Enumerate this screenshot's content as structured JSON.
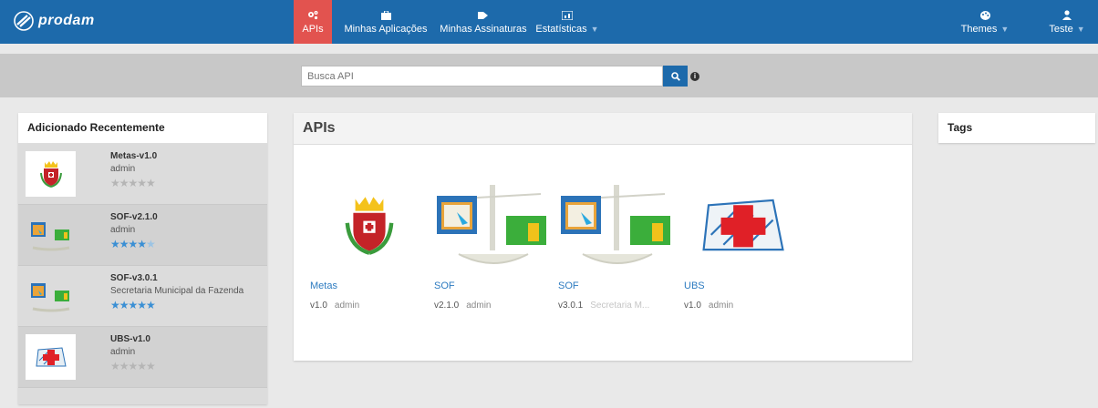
{
  "brand": {
    "name": "prodam"
  },
  "nav": {
    "items": [
      {
        "label": "APIs",
        "icon": "gears-icon",
        "active": true
      },
      {
        "label": "Minhas Aplicações",
        "icon": "briefcase-icon"
      },
      {
        "label": "Minhas Assinaturas",
        "icon": "tag-icon"
      },
      {
        "label": "Estatísticas",
        "icon": "chart-icon",
        "caret": "▼"
      }
    ],
    "right": [
      {
        "label": "Themes",
        "icon": "palette-icon",
        "caret": "▼"
      },
      {
        "label": "Teste",
        "icon": "user-icon",
        "caret": "▼"
      }
    ]
  },
  "search": {
    "placeholder": "Busca API",
    "value": ""
  },
  "recent": {
    "title": "Adicionado Recentemente",
    "items": [
      {
        "title": "Metas-v1.0",
        "subtitle": "admin",
        "rating": 0
      },
      {
        "title": "SOF-v2.1.0",
        "subtitle": "admin",
        "rating": 4.5
      },
      {
        "title": "SOF-v3.0.1",
        "subtitle": "Secretaria Municipal da Fazenda",
        "rating": 5
      },
      {
        "title": "UBS-v1.0",
        "subtitle": "admin",
        "rating": 0
      }
    ]
  },
  "apis": {
    "title": "APIs",
    "cards": [
      {
        "name": "Metas",
        "version": "v1.0",
        "owner": "admin"
      },
      {
        "name": "SOF",
        "version": "v2.1.0",
        "owner": "admin"
      },
      {
        "name": "SOF",
        "version": "v3.0.1",
        "owner": "Secretaria M..."
      },
      {
        "name": "UBS",
        "version": "v1.0",
        "owner": "admin"
      }
    ]
  },
  "tags": {
    "title": "Tags"
  },
  "colors": {
    "navbar": "#1d6aab",
    "active_tab": "#e2534f",
    "link": "#2d7bc0",
    "star_on": "#3a8fd4",
    "star_off": "#b5b5b5"
  }
}
